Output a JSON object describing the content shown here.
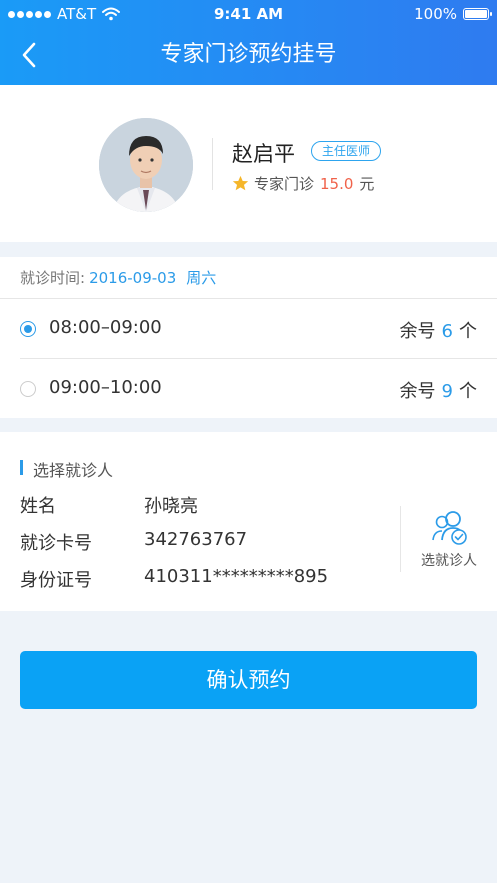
{
  "status_bar": {
    "carrier": "AT&T",
    "time": "9:41 AM",
    "battery": "100%"
  },
  "nav": {
    "title": "专家门诊预约挂号",
    "back_icon": "chevron-left-icon"
  },
  "doctor": {
    "name": "赵启平",
    "title_badge": "主任医师",
    "clinic_type": "专家门诊",
    "fee": "15.0",
    "fee_unit": "元",
    "star_color": "#f5b62a"
  },
  "schedule": {
    "date_label": "就诊时间:",
    "date": "2016-09-03",
    "weekday": "周六",
    "slots": [
      {
        "time": "08:00–09:00",
        "remain_label": "余号",
        "remain_count": "6",
        "unit": "个",
        "selected": true
      },
      {
        "time": "09:00–10:00",
        "remain_label": "余号",
        "remain_count": "9",
        "unit": "个",
        "selected": false
      }
    ]
  },
  "patient": {
    "section_title": "选择就诊人",
    "fields": [
      {
        "label": "姓名",
        "value": "孙晓亮"
      },
      {
        "label": "就诊卡号",
        "value": "342763767"
      },
      {
        "label": "身份证号",
        "value": "410311*********895"
      }
    ],
    "select_label": "选就诊人"
  },
  "confirm_button": "确认预约",
  "colors": {
    "accent": "#2b9be8",
    "price": "#f0624a",
    "button": "#0aa2f5"
  }
}
